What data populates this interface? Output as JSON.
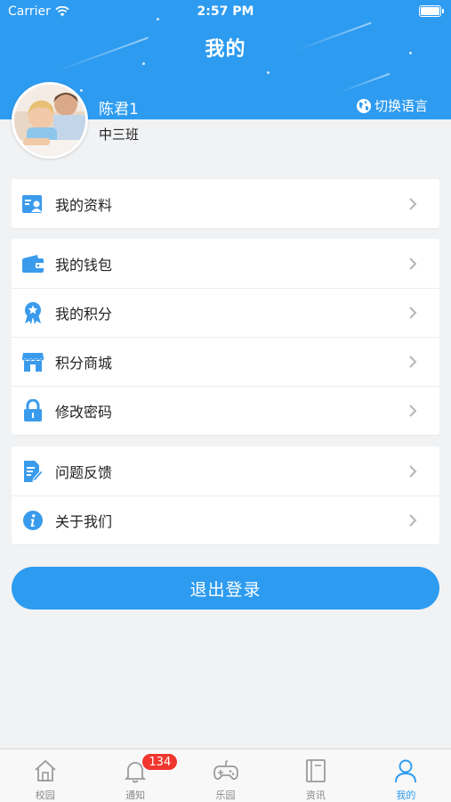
{
  "status_bar": {
    "carrier": "Carrier",
    "time": "2:57 PM"
  },
  "header": {
    "title": "我的"
  },
  "profile": {
    "name": "陈君1",
    "class_name": "中三班",
    "switch_language": "切换语言",
    "avatar_icon": "child-photo-avatar"
  },
  "menu_groups": [
    {
      "items": [
        {
          "label": "我的资料",
          "icon": "profile-card-icon"
        }
      ]
    },
    {
      "items": [
        {
          "label": "我的钱包",
          "icon": "wallet-icon"
        },
        {
          "label": "我的积分",
          "icon": "award-medal-icon"
        },
        {
          "label": "积分商城",
          "icon": "store-icon"
        },
        {
          "label": "修改密码",
          "icon": "lock-icon"
        }
      ]
    },
    {
      "items": [
        {
          "label": "问题反馈",
          "icon": "feedback-edit-icon"
        },
        {
          "label": "关于我们",
          "icon": "info-icon"
        }
      ]
    }
  ],
  "logout": {
    "label": "退出登录"
  },
  "tabbar": {
    "tabs": [
      {
        "label": "校园",
        "icon": "home-icon"
      },
      {
        "label": "通知",
        "icon": "bell-icon",
        "badge": "134"
      },
      {
        "label": "乐园",
        "icon": "gamepad-icon"
      },
      {
        "label": "资讯",
        "icon": "book-icon"
      },
      {
        "label": "我的",
        "icon": "user-icon",
        "active": true
      }
    ]
  },
  "colors": {
    "primary": "#2d9bf0",
    "background": "#f1f2f4",
    "badge": "#f0362d",
    "icon_blue": "#3a9bec"
  }
}
